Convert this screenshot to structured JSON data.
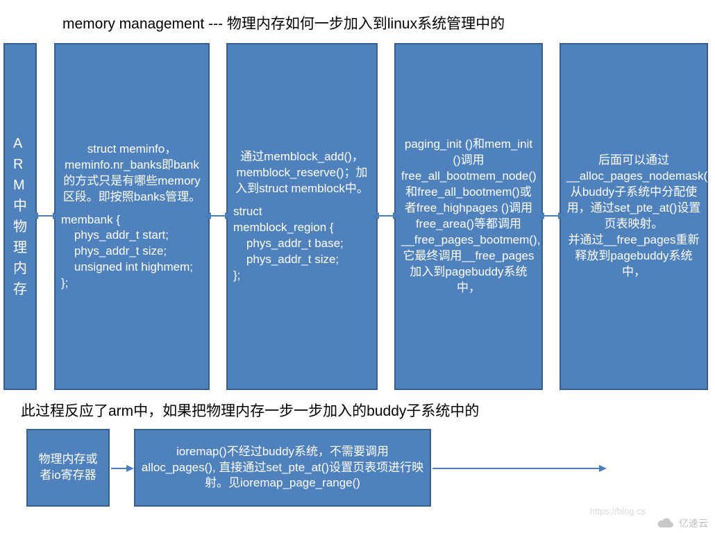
{
  "title": "memory management --- 物理内存如何一步加入到linux系统管理中的",
  "mid_text": "此过程反应了arm中，如果把物理内存一步一步加入的buddy子系统中的",
  "boxes": {
    "b0": "ARM中物理内存",
    "b1_top": "struct meminfo，meminfo.nr_banks即bank的方式只是有哪些memory区段。即按照banks管理。",
    "b1_code": "membank {\n    phys_addr_t start;\n    phys_addr_t size;\n    unsigned int highmem;\n};",
    "b2_top": "通过memblock_add()，memblock_reserve()；加入到struct memblock中。",
    "b2_code": "struct\nmemblock_region {\n    phys_addr_t base;\n    phys_addr_t size;\n};",
    "b3": "paging_init ()和mem_init ()调用free_all_bootmem_node()和free_all_bootmem()或者free_highpages ()调用free_area()等都调用__free_pages_bootmem(),它最终调用__free_pages加入到pagebuddy系统中，",
    "b4": "后面可以通过__alloc_pages_nodemask()从buddy子系统中分配使用，通过set_pte_at()设置页表映射。\n并通过__free_pages重新释放到pagebuddy系统中，",
    "b5": "物理内存或者io寄存器",
    "b6": "ioremap()不经过buddy系统，不需要调用alloc_pages(), 直接通过set_pte_at()设置页表项进行映射。见ioremap_page_range()"
  },
  "watermark": {
    "link": "https://blog.cs",
    "brand": "亿速云"
  }
}
